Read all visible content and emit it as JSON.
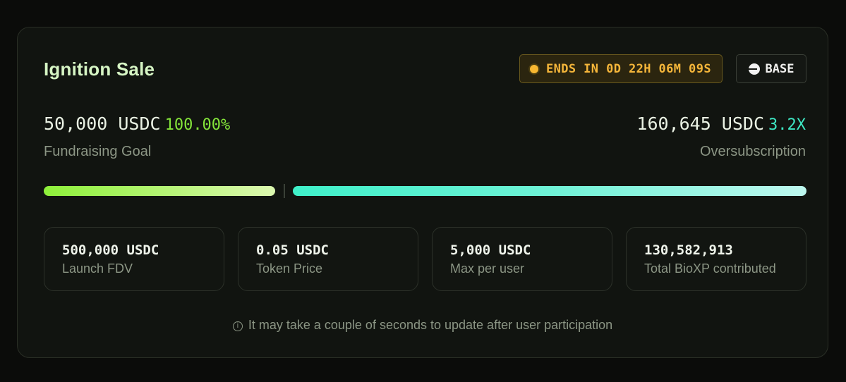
{
  "sale": {
    "title": "Ignition Sale",
    "timer_label": "ENDS IN 0D 22H 06M 09S",
    "network_label": "BASE"
  },
  "fundraising": {
    "amount": "50,000 USDC",
    "percent": "100.00%",
    "label": "Fundraising Goal",
    "progress_fraction": 1.0
  },
  "oversubscription": {
    "amount": "160,645 USDC",
    "multiplier": "3.2X",
    "label": "Oversubscription"
  },
  "stats": [
    {
      "value": "500,000 USDC",
      "label": "Launch FDV"
    },
    {
      "value": "0.05 USDC",
      "label": "Token Price"
    },
    {
      "value": "5,000 USDC",
      "label": "Max per user"
    },
    {
      "value": "130,582,913",
      "label": "Total BioXP contributed"
    }
  ],
  "note": {
    "icon": "info-icon",
    "text": "It may take a couple of seconds to update after user participation"
  },
  "colors": {
    "accent_green": "#84e43a",
    "accent_teal": "#3ee8c4",
    "timer_amber": "#f5b63a"
  }
}
